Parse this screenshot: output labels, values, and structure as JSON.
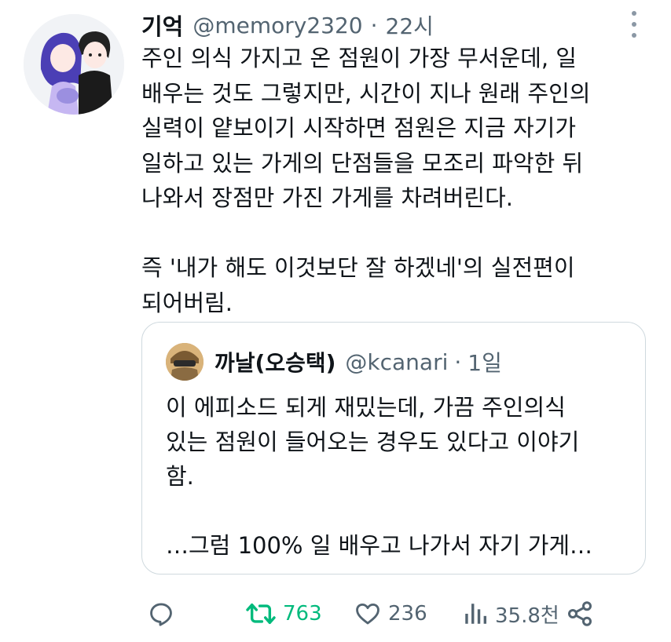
{
  "tweet": {
    "display_name": "기억",
    "handle": "@memory2320",
    "separator": "·",
    "time": "22시",
    "body_lines": [
      "주인 의식 가지고 온 점원이 가장 무서운데, 일",
      "배우는 것도 그렇지만, 시간이 지나 원래 주인의",
      "실력이 얕보이기 시작하면 점원은 지금 자기가",
      "일하고 있는 가게의 단점들을 모조리 파악한 뒤",
      "나와서 장점만 가진 가게를 차려버린다.",
      "",
      "즉 '내가 해도 이것보단 잘 하겠네'의 실전편이",
      "되어버림."
    ]
  },
  "quoted": {
    "display_name": "까날(오승택)",
    "handle": "@kcanari",
    "separator": "·",
    "time": "1일",
    "body_lines": [
      "이 에피소드 되게 재밌는데, 가끔 주인의식",
      "있는 점원이 들어오는 경우도 있다고 이야기",
      "함.",
      "",
      "…그럼 100% 일 배우고 나가서 자기 가게…"
    ]
  },
  "actions": {
    "reply_icon": "reply-icon",
    "retweet_icon": "retweet-icon",
    "retweet_count": "763",
    "like_icon": "heart-icon",
    "like_count": "236",
    "views_icon": "views-icon",
    "views_count": "35.8천",
    "share_icon": "share-icon"
  },
  "colors": {
    "text": "#0f1419",
    "secondary": "#536471",
    "retweet_green": "#00ba7c",
    "border": "#cfd9de"
  }
}
